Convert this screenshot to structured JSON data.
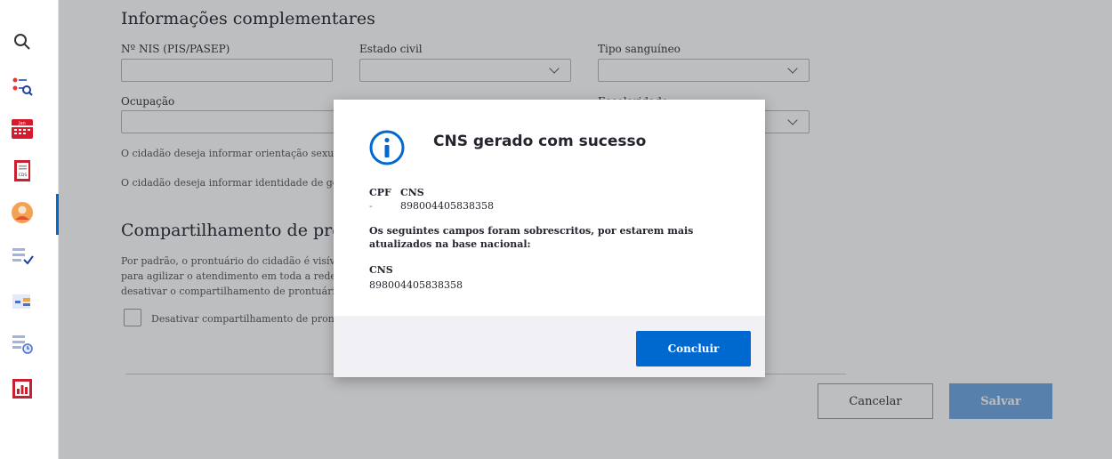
{
  "sidebar": {
    "items": [
      {
        "icon": "search-icon"
      },
      {
        "icon": "citizen-search-icon"
      },
      {
        "icon": "calendar-icon",
        "label": "Jan"
      },
      {
        "icon": "records-icon",
        "label": "CDS"
      },
      {
        "icon": "citizen-icon"
      },
      {
        "icon": "list-check-icon"
      },
      {
        "icon": "list-tag-icon"
      },
      {
        "icon": "list-clock-icon"
      },
      {
        "icon": "report-chart-icon"
      }
    ]
  },
  "form": {
    "section_title": "Informações complementares",
    "nis_label": "Nº NIS (PIS/PASEP)",
    "estado_civil_label": "Estado civil",
    "tipo_sanguineo_label": "Tipo sanguíneo",
    "ocupacao_label": "Ocupação",
    "escolaridade_label": "Escolaridade",
    "orientacao_text": "O cidadão deseja informar orientação sexual?",
    "identidade_text": "O cidadão deseja informar identidade de gênero?",
    "share_section_title": "Compartilhamento de prontuário",
    "share_description": "Por padrão, o prontuário do cidadão é visível para todas as unidades de saúde do município para agilizar o atendimento em toda a rede. Apenas em casos excepcionais, deve-se desativar o compartilhamento de prontuário.",
    "share_checkbox_label": "Desativar compartilhamento de prontuário",
    "cancel_label": "Cancelar",
    "save_label": "Salvar"
  },
  "modal": {
    "title": "CNS gerado com sucesso",
    "cpf_label": "CPF",
    "cpf_value": "-",
    "cns_label": "CNS",
    "cns_value": "898004405838358",
    "message": "Os seguintes campos foram sobrescritos, por estarem mais atualizados na base nacional:",
    "field_label": "CNS",
    "field_value": "898004405838358",
    "conclude_label": "Concluir"
  },
  "colors": {
    "primary": "#0069d0",
    "save_disabled": "#6fa7e4",
    "overlay": "rgba(38,39,48,0.30)"
  }
}
